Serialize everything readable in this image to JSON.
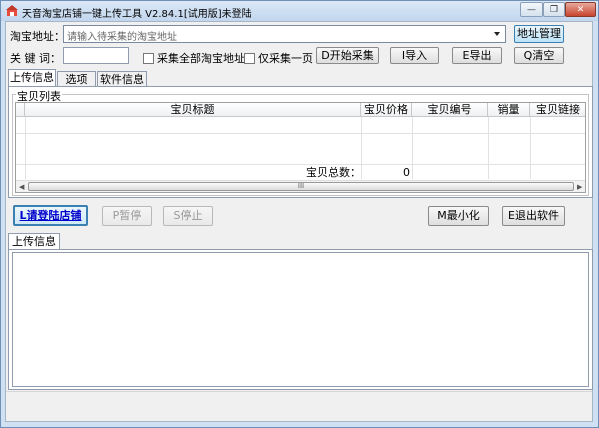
{
  "window": {
    "title": "天音淘宝店铺一键上传工具 V2.84.1[试用版]未登陆",
    "minimize_glyph": "—",
    "restore_glyph": "❐",
    "close_glyph": "✕"
  },
  "form": {
    "url_label": "淘宝地址：",
    "url_placeholder": "请输入待采集的淘宝地址",
    "url_manage_button": "地址管理",
    "keyword_label": "关 键 词：",
    "keyword_value": "",
    "collect_all_checkbox": "采集全部淘宝地址",
    "collect_all_checked": false,
    "single_page_checkbox": "仅采集一页",
    "single_page_checked": false,
    "start_button": "D开始采集",
    "import_button": "I导入",
    "export_button": "E导出",
    "clear_button": "Q清空"
  },
  "tabs": [
    {
      "label": "上传信息",
      "active": true
    },
    {
      "label": "选项",
      "active": false
    },
    {
      "label": "软件信息",
      "active": false
    }
  ],
  "items_table": {
    "group_title": "宝贝列表",
    "columns": [
      "宝贝标题",
      "宝贝价格",
      "宝贝编号",
      "销量",
      "宝贝链接"
    ],
    "total_label": "宝贝总数：",
    "total_value": "0",
    "scroll_left": "◀",
    "scroll_right": "▶",
    "scroll_grip": "III"
  },
  "actions": {
    "login_button": "L请登陆店铺",
    "pause_button": "P暂停",
    "stop_button": "S停止",
    "minimize_button": "M最小化",
    "exit_button": "E退出软件"
  },
  "log": {
    "tab_label": "上传信息",
    "content": ""
  }
}
